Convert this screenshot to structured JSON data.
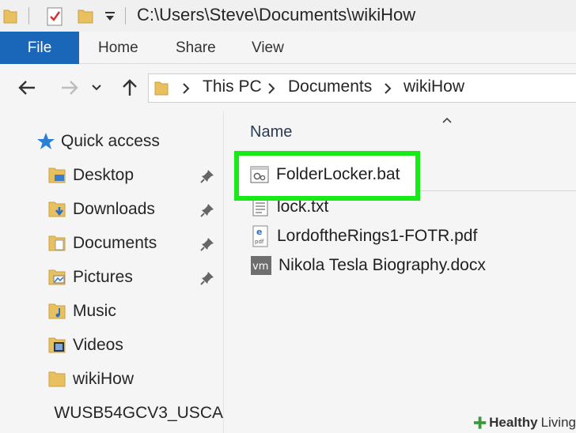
{
  "window": {
    "title_path": "C:\\Users\\Steve\\Documents\\wikiHow"
  },
  "ribbon": {
    "tabs": [
      {
        "label": "File",
        "active": true
      },
      {
        "label": "Home"
      },
      {
        "label": "Share"
      },
      {
        "label": "View"
      }
    ]
  },
  "address_bar": {
    "crumbs": [
      "This PC",
      "Documents",
      "wikiHow"
    ]
  },
  "nav_pane": {
    "quick_access": "Quick access",
    "items": [
      {
        "label": "Desktop",
        "pinned": true
      },
      {
        "label": "Downloads",
        "pinned": true
      },
      {
        "label": "Documents",
        "pinned": true
      },
      {
        "label": "Pictures",
        "pinned": true
      },
      {
        "label": "Music"
      },
      {
        "label": "Videos"
      },
      {
        "label": "wikiHow"
      },
      {
        "label": "WUSB54GCV3_USCA"
      }
    ]
  },
  "content": {
    "column_header": "Name",
    "files": [
      {
        "name": "FolderLocker.bat",
        "icon": "bat-file-icon",
        "highlighted": true
      },
      {
        "name": "lock.txt",
        "icon": "txt-file-icon"
      },
      {
        "name": "LordoftheRings1-FOTR.pdf",
        "icon": "pdf-file-icon"
      },
      {
        "name": "Nikola Tesla Biography.docx",
        "icon": "docx-file-icon"
      }
    ]
  },
  "watermark": {
    "brand": "Healthy",
    "brand2": "Living"
  },
  "colors": {
    "file_tab": "#1a66b8",
    "highlight": "#18ea18",
    "folder": "#e8c060",
    "quick_access_star": "#2b7fd4"
  }
}
